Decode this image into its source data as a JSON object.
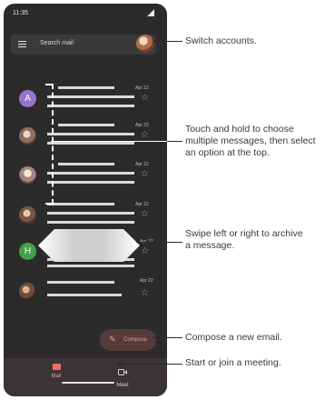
{
  "status": {
    "time": "11:35"
  },
  "search": {
    "placeholder": "Search mail"
  },
  "emails": [
    {
      "avatar_letter": "A",
      "avatar_color": "#9575cd",
      "date": "Apr 22"
    },
    {
      "avatar_letter": "",
      "avatar_color": "#8d6e63",
      "date": "Apr 22"
    },
    {
      "avatar_letter": "",
      "avatar_color": "#a1887f",
      "date": "Apr 22"
    },
    {
      "avatar_letter": "",
      "avatar_color": "#795548",
      "date": "Apr 22"
    },
    {
      "avatar_letter": "H",
      "avatar_color": "#43a047",
      "date": "Apr 22"
    },
    {
      "avatar_letter": "",
      "avatar_color": "#6d4c41",
      "date": "Apr 22"
    }
  ],
  "compose": {
    "label": "Compose"
  },
  "nav": {
    "mail_label": "Mail",
    "meet_label": "Meet"
  },
  "callouts": {
    "switch_accounts": "Switch accounts.",
    "touch_hold": "Touch and hold to choose multiple messages, then select an option at the top.",
    "swipe": "Swipe left or right to archive a message.",
    "compose": "Compose a new email.",
    "meeting": "Start or join a meeting."
  },
  "colors": {
    "accent": "#ef6c6c",
    "phone_bg": "#2b2b2b"
  },
  "icons": [
    "menu-icon",
    "signal-icon",
    "star-icon",
    "pencil-icon",
    "mail-icon",
    "video-icon"
  ]
}
